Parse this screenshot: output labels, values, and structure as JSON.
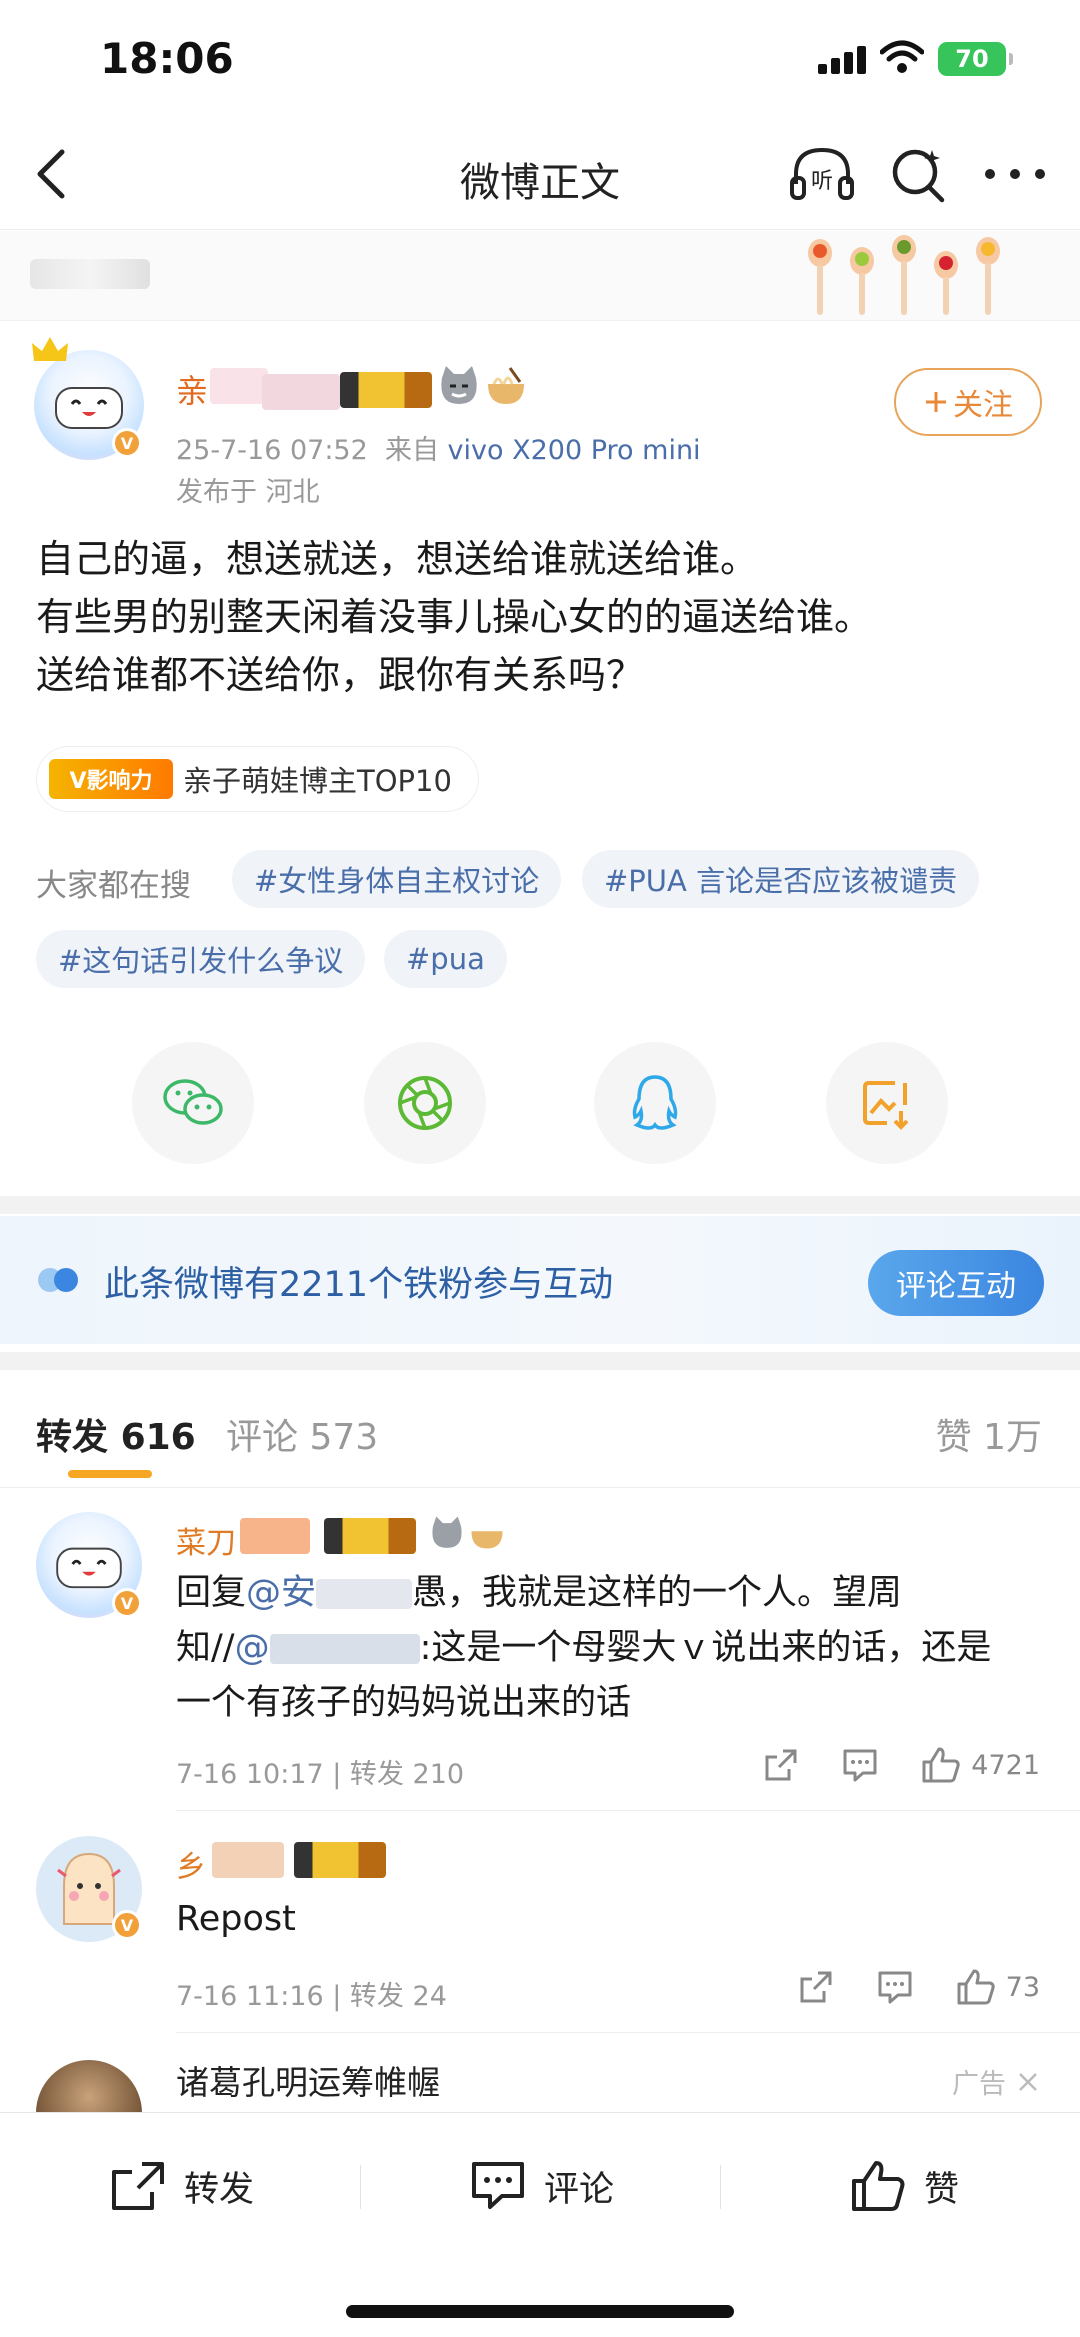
{
  "status": {
    "time": "18:06",
    "battery": "70"
  },
  "nav": {
    "title": "微博正文",
    "listen_icon_text": "听"
  },
  "post": {
    "username_visible": "亲",
    "meta_date": "25-7-16 07:52",
    "meta_source_prefix": "来自",
    "meta_source": "vivo X200 Pro mini",
    "location": "发布于 河北",
    "follow_label": "关注",
    "content_lines": [
      "自己的逼，想送就送，想送给谁就送给谁。",
      "有些男的别整天闲着没事儿操心女的的逼送给谁。",
      "送给谁都不送给你，跟你有关系吗？"
    ],
    "influence_logo": "V影响力",
    "influence_text": "亲子萌娃博主TOP10"
  },
  "search": {
    "label": "大家都在搜",
    "chips": [
      "#女性身体自主权讨论",
      "#PUA 言论是否应该被谴责",
      "#这句话引发什么争议",
      "#pua"
    ]
  },
  "share_icons": [
    "wechat-icon",
    "moments-icon",
    "qq-icon",
    "save-image-icon"
  ],
  "fans": {
    "text": "此条微博有2211个铁粉参与互动",
    "button": "评论互动"
  },
  "tabs": {
    "repost_label": "转发",
    "repost_count": "616",
    "comment_label": "评论",
    "comment_count": "573",
    "like_label": "赞",
    "like_count": "1万"
  },
  "reposts": [
    {
      "name_visible": "菜刀",
      "text_a": "回复",
      "mention_a": "@安",
      "text_b": "愚，我就是这样的一个人。望周",
      "text_c": "知//",
      "mention_b": "@",
      "text_d": ":这是一个母婴大ｖ说出来的话，还是",
      "line3": "一个有孩子的妈妈说出来的话",
      "meta": "7-16 10:17 | 转发 210",
      "likes": "4721"
    },
    {
      "name_visible": "乡",
      "text": "Repost",
      "meta": "7-16 11:16 | 转发 24",
      "likes": "73"
    }
  ],
  "ad": {
    "name": "诸葛孔明运筹帷幄",
    "tag": "广告"
  },
  "bottom": {
    "repost": "转发",
    "comment": "评论",
    "like": "赞"
  },
  "colors": {
    "accent_orange": "#f5a623",
    "link_blue": "#4a6ea9",
    "fans_blue": "#2d5fa4"
  }
}
